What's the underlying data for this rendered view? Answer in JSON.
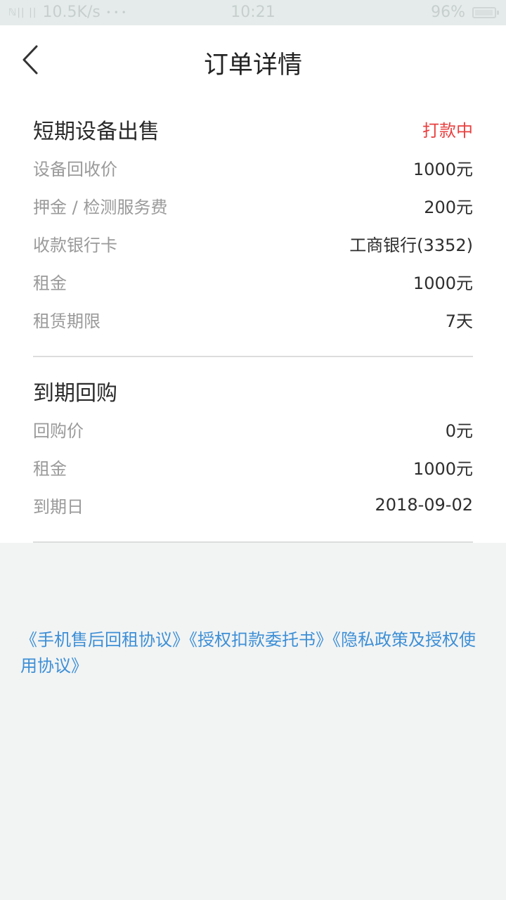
{
  "status_bar": {
    "signal": "ℕ|| ||",
    "speed": "10.5K/s",
    "dots": "• • •",
    "time": "10:21",
    "battery": "96%",
    "battery_level": 0.96
  },
  "nav": {
    "title": "订单详情"
  },
  "section_sale": {
    "title": "短期设备出售",
    "status": "打款中",
    "rows": [
      {
        "label": "设备回收价",
        "value": "1000元"
      },
      {
        "label": "押金 / 检测服务费",
        "value": "200元"
      },
      {
        "label": "收款银行卡",
        "value": "工商银行(3352)"
      },
      {
        "label": "租金",
        "value": "1000元"
      },
      {
        "label": "租赁期限",
        "value": "7天"
      }
    ]
  },
  "section_buyback": {
    "title": "到期回购",
    "rows": [
      {
        "label": "回购价",
        "value": "0元"
      },
      {
        "label": "租金",
        "value": "1000元"
      },
      {
        "label": "到期日",
        "value": "2018-09-02"
      }
    ]
  },
  "agreements": [
    "《手机售后回租协议》",
    "《授权扣款委托书》",
    "《隐私政策及授权使用协议》"
  ],
  "colors": {
    "accent_link": "#3e8fd6",
    "status_red": "#e94040",
    "page_bg": "#f2f4f4"
  }
}
